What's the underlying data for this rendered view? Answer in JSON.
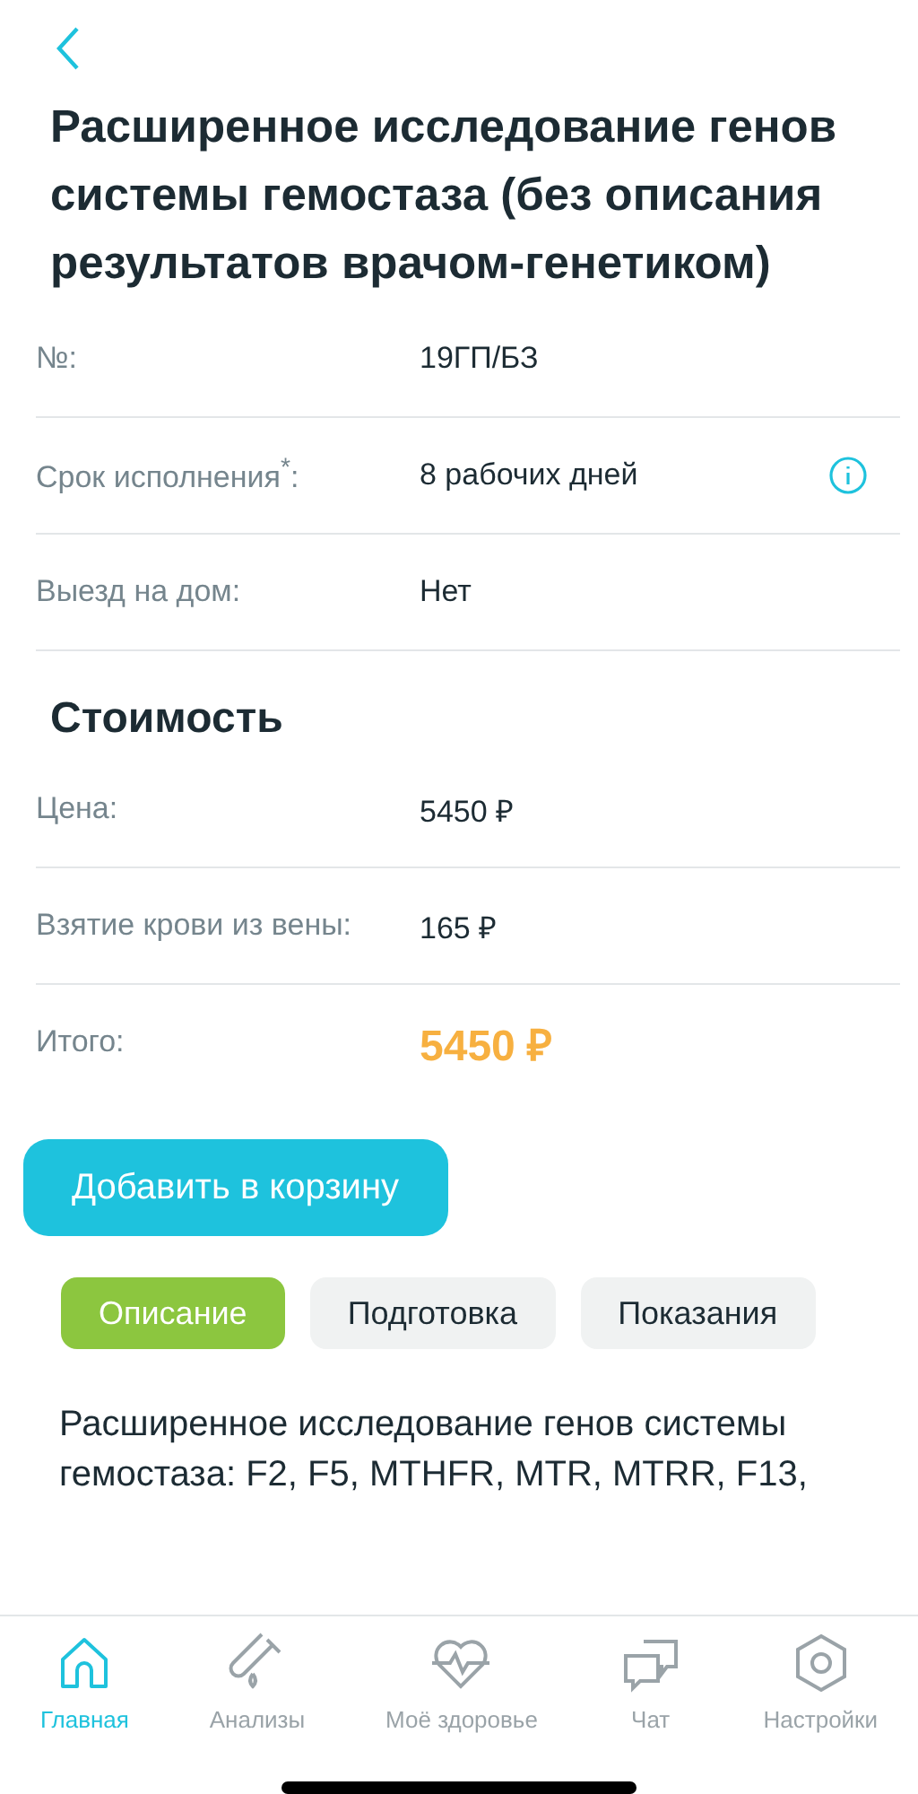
{
  "title": "Расширенное исследование генов системы гемостаза (без описания результатов врачом-генетиком)",
  "details": [
    {
      "label": "№:",
      "value": "19ГП/БЗ",
      "info": false
    },
    {
      "label": "Срок исполнения$^{*}$:",
      "value": "8 рабочих дней",
      "info": true
    },
    {
      "label": "Выезд на дом:",
      "value": "Нет",
      "info": false
    }
  ],
  "cost": {
    "heading": "Стоимость",
    "rows": [
      {
        "label": "Цена:",
        "value": "5450 ₽",
        "kind": "plain"
      },
      {
        "label": "Взятие крови из вены:",
        "value": "165 ₽",
        "kind": "plain"
      },
      {
        "label": "Итого:",
        "value": "5450 ₽",
        "kind": "total"
      }
    ]
  },
  "add_button": "Добавить в корзину",
  "tabs": [
    {
      "label": "Описание",
      "selected": true
    },
    {
      "label": "Подготовка",
      "selected": false
    },
    {
      "label": "Показания",
      "selected": false
    }
  ],
  "description": "Расширенное исследование генов системы гемостаза: F2, F5, MTHFR, MTR, MTRR, F13,",
  "nav": [
    {
      "label": "Главная",
      "kind": "home",
      "selected": true
    },
    {
      "label": "Анализы",
      "kind": "tube",
      "selected": false
    },
    {
      "label": "Моё здоровье",
      "kind": "heart",
      "selected": false
    },
    {
      "label": "Чат",
      "kind": "chat",
      "selected": false
    },
    {
      "label": "Настройки",
      "kind": "settings",
      "selected": false
    }
  ]
}
